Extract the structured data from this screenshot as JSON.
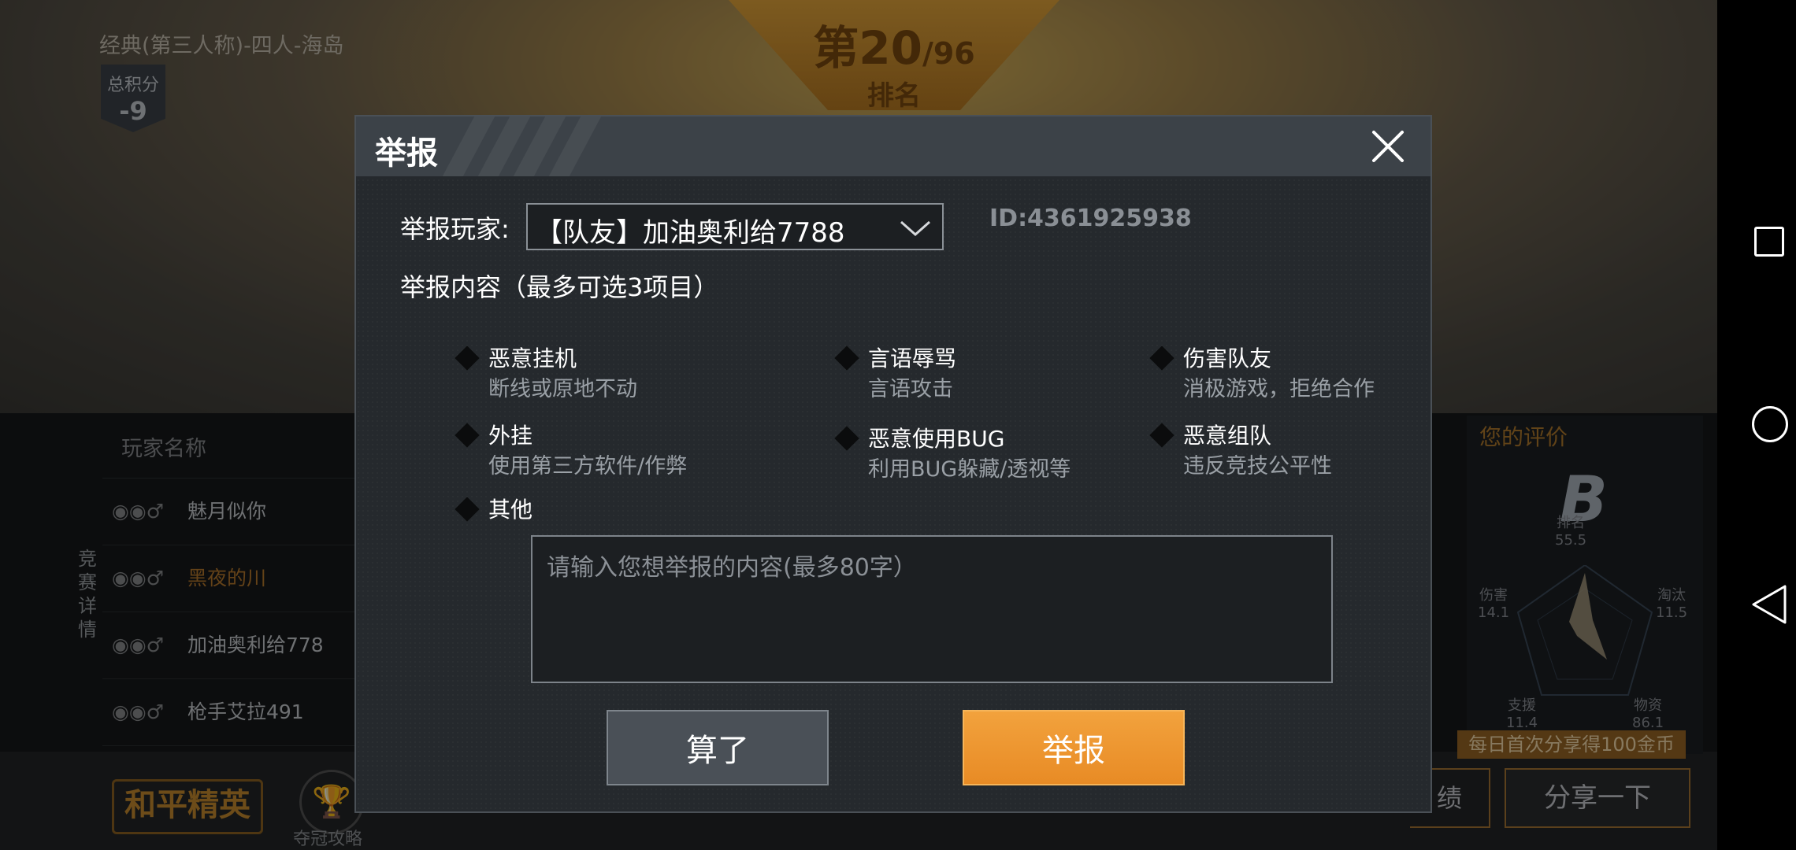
{
  "background": {
    "mode_label": "经典(第三人称)-四人-海岛",
    "score": {
      "label": "总积分",
      "value": "-9"
    },
    "rank": {
      "prefix": "第20",
      "total": "/96",
      "label": "排名"
    },
    "table": {
      "header": "玩家名称",
      "side_tab": "竞赛详情",
      "rows": [
        {
          "name": "魅月似你"
        },
        {
          "name": "黑夜的川"
        },
        {
          "name": "加油奥利给778"
        },
        {
          "name": "枪手艾拉491"
        }
      ]
    },
    "rating": {
      "title": "您的评价",
      "grade": "B",
      "stats": [
        {
          "label": "排名",
          "value": "55.5"
        },
        {
          "label": "伤害",
          "value": "14.1"
        },
        {
          "label": "淘汰",
          "value": "11.5"
        },
        {
          "label": "支援",
          "value": "11.4"
        },
        {
          "label": "物资",
          "value": "86.1"
        }
      ]
    },
    "share_promo": "每日首次分享得100金币",
    "share_button": "分享一下",
    "result_button_fragment": "绩",
    "brand_logo": "和平精英",
    "trophy_label": "夺冠攻略"
  },
  "dialog": {
    "title": "举报",
    "player_label": "举报玩家:",
    "player_value": "【队友】加油奥利给7788",
    "player_id": "ID:4361925938",
    "content_label": "举报内容（最多可选3项目）",
    "options": [
      {
        "title": "恶意挂机",
        "desc": "断线或原地不动"
      },
      {
        "title": "言语辱骂",
        "desc": "言语攻击"
      },
      {
        "title": "伤害队友",
        "desc": "消极游戏，拒绝合作"
      },
      {
        "title": "外挂",
        "desc": "使用第三方软件/作弊"
      },
      {
        "title": "恶意使用BUG",
        "desc": "利用BUG躲藏/透视等"
      },
      {
        "title": "恶意组队",
        "desc": "违反竞技公平性"
      },
      {
        "title": "其他",
        "desc": ""
      }
    ],
    "textarea_placeholder": "请输入您想举报的内容(最多80字）",
    "textarea_value": "",
    "cancel_label": "算了",
    "submit_label": "举报"
  },
  "colors": {
    "dialog_bg": "#25292d",
    "dialog_header": "#3c4248",
    "submit_accent": "#e88b25",
    "cancel_bg": "#4a5057"
  },
  "icons": {
    "close": "close-icon",
    "dropdown": "chevron-down-icon",
    "checkbox": "diamond-checkbox-icon",
    "nav_recents": "square-icon",
    "nav_home": "circle-icon",
    "nav_back": "triangle-back-icon"
  }
}
